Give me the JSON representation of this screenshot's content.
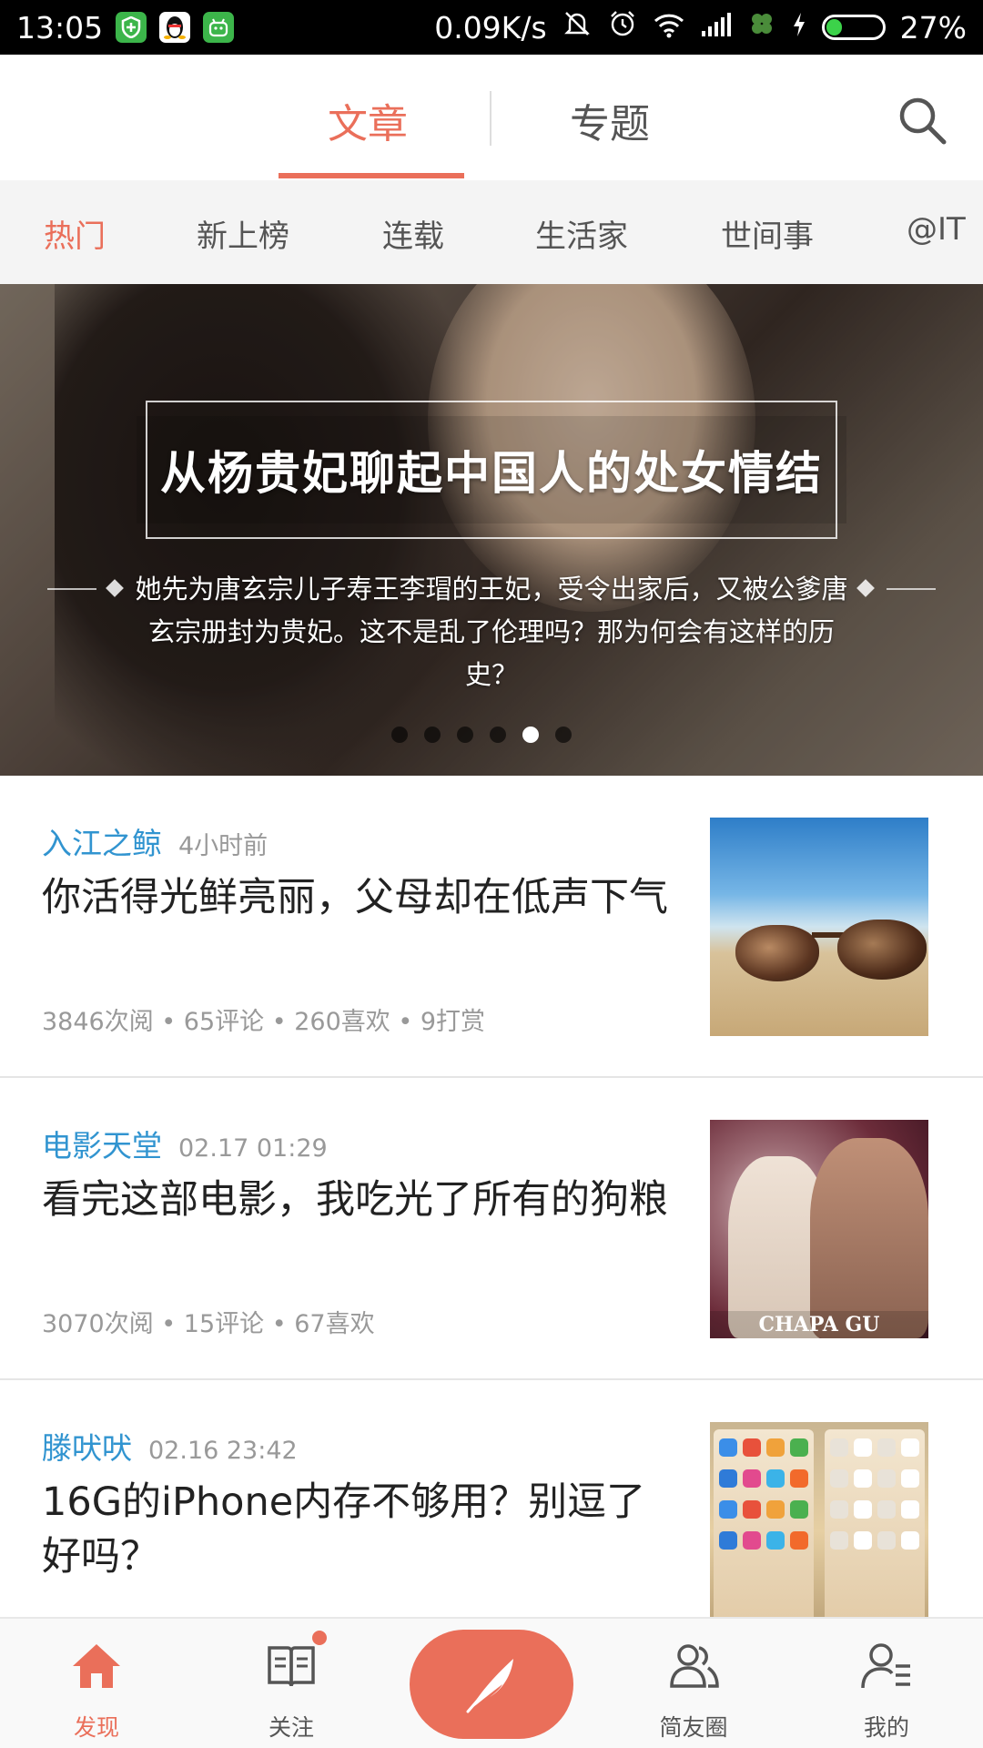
{
  "status_bar": {
    "time": "13:05",
    "network_speed": "0.09K/s",
    "battery_percent": "27%",
    "battery_level": 0.27
  },
  "top_tabs": {
    "items": [
      {
        "label": "文章",
        "active": true
      },
      {
        "label": "专题",
        "active": false
      }
    ]
  },
  "categories": [
    {
      "label": "热门",
      "active": true
    },
    {
      "label": "新上榜",
      "active": false
    },
    {
      "label": "连载",
      "active": false
    },
    {
      "label": "生活家",
      "active": false
    },
    {
      "label": "世间事",
      "active": false
    },
    {
      "label": "@IT",
      "active": false
    }
  ],
  "banner": {
    "title": "从杨贵妃聊起中国人的处女情结",
    "description": "她先为唐玄宗儿子寿王李瑁的王妃，受令出家后，又被公爹唐玄宗册封为贵妃。这不是乱了伦理吗？那为何会有这样的历史？",
    "dot_count": 6,
    "active_dot": 4
  },
  "articles": [
    {
      "author": "入江之鲸",
      "time": "4小时前",
      "title": "你活得光鲜亮丽，父母却在低声下气",
      "meta": "3846次阅 • 65评论 • 260喜欢 • 9打赏"
    },
    {
      "author": "电影天堂",
      "time": "02.17 01:29",
      "title": "看完这部电影，我吃光了所有的狗粮",
      "meta": "3070次阅 • 15评论 • 67喜欢",
      "thumb_caption": "CHAPA  GU"
    },
    {
      "author": "滕吠吠",
      "time": "02.16 23:42",
      "title": "16G的iPhone内存不够用？别逗了好吗？",
      "meta": ""
    }
  ],
  "bottom_nav": {
    "items": [
      {
        "label": "发现",
        "icon": "home-icon",
        "active": true
      },
      {
        "label": "关注",
        "icon": "book-icon",
        "active": false,
        "has_badge": true
      },
      {
        "label": "",
        "icon": "feather-icon",
        "active": false
      },
      {
        "label": "简友圈",
        "icon": "friends-icon",
        "active": false
      },
      {
        "label": "我的",
        "icon": "profile-icon",
        "active": false
      }
    ]
  },
  "colors": {
    "accent": "#ea6f5a",
    "author_link": "#3194d0",
    "muted": "#999999"
  }
}
